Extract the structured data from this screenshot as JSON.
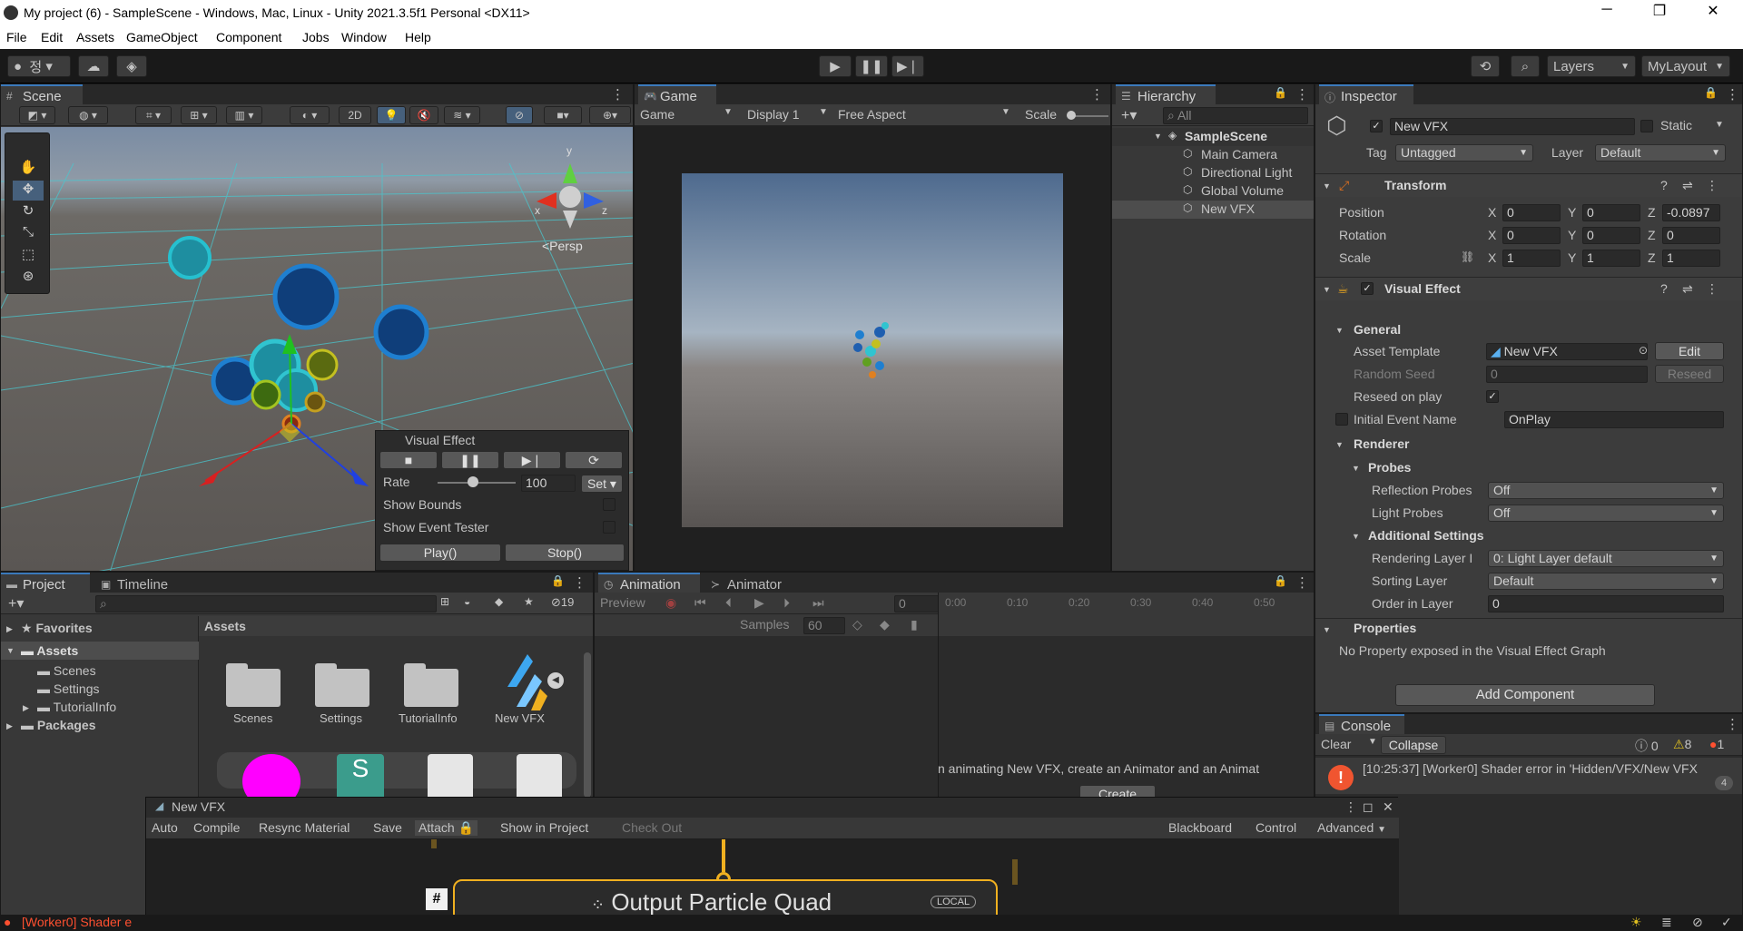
{
  "window": {
    "title": "My project (6) - SampleScene - Windows, Mac, Linux - Unity 2021.3.5f1 Personal <DX11>",
    "minimize": "─",
    "restore": "❐",
    "close": "✕"
  },
  "menu": [
    "File",
    "Edit",
    "Assets",
    "GameObject",
    "Component",
    "Jobs",
    "Window",
    "Help"
  ],
  "toolbar": {
    "account_label": "정",
    "layers_label": "Layers",
    "layout_label": "MyLayout"
  },
  "scene": {
    "tab": "Scene",
    "mode_2d": "2D",
    "persp_label": "<Persp",
    "gizmo_x": "x",
    "gizmo_y": "y",
    "gizmo_z": "z",
    "vfx_overlay": {
      "title": "Visual Effect",
      "rate_label": "Rate",
      "rate_value": "100",
      "set_label": "Set",
      "show_bounds": "Show Bounds",
      "show_event_tester": "Show Event Tester",
      "play": "Play()",
      "stop": "Stop()",
      "rate_fraction": 0.45
    }
  },
  "game": {
    "tab": "Game",
    "mode": "Game",
    "display": "Display 1",
    "aspect": "Free Aspect",
    "scale_label": "Scale"
  },
  "hierarchy": {
    "tab": "Hierarchy",
    "search_placeholder": "All",
    "scene_name": "SampleScene",
    "items": [
      "Main Camera",
      "Directional Light",
      "Global Volume",
      "New VFX"
    ],
    "selected": "New VFX"
  },
  "inspector": {
    "tab": "Inspector",
    "object_name": "New VFX",
    "static_label": "Static",
    "tag_label": "Tag",
    "tag_value": "Untagged",
    "layer_label": "Layer",
    "layer_value": "Default",
    "transform": {
      "title": "Transform",
      "position_label": "Position",
      "rotation_label": "Rotation",
      "scale_label": "Scale",
      "position": {
        "x": "0",
        "y": "0",
        "z": "-0.0897"
      },
      "rotation": {
        "x": "0",
        "y": "0",
        "z": "0"
      },
      "scale": {
        "x": "1",
        "y": "1",
        "z": "1"
      },
      "axis_x": "X",
      "axis_y": "Y",
      "axis_z": "Z"
    },
    "visual_effect": {
      "title": "Visual Effect",
      "general": "General",
      "asset_template_label": "Asset Template",
      "asset_template_value": "New VFX",
      "edit": "Edit",
      "random_seed_label": "Random Seed",
      "random_seed_value": "0",
      "reseed": "Reseed",
      "reseed_on_play_label": "Reseed on play",
      "initial_event_label": "Initial Event Name",
      "initial_event_value": "OnPlay",
      "renderer": "Renderer",
      "probes": "Probes",
      "reflection_probes_label": "Reflection Probes",
      "reflection_probes_value": "Off",
      "light_probes_label": "Light Probes",
      "light_probes_value": "Off",
      "additional_settings": "Additional Settings",
      "rendering_layer_label": "Rendering Layer I",
      "rendering_layer_value": "0: Light Layer default",
      "sorting_layer_label": "Sorting Layer",
      "sorting_layer_value": "Default",
      "order_label": "Order in Layer",
      "order_value": "0",
      "properties": "Properties",
      "no_property": "No Property exposed in the Visual Effect Graph"
    },
    "add_component": "Add Component"
  },
  "project": {
    "tab": "Project",
    "timeline_tab": "Timeline",
    "hidden_count": "19",
    "favorites": "Favorites",
    "assets": "Assets",
    "folders": [
      "Scenes",
      "Settings",
      "TutorialInfo"
    ],
    "packages": "Packages",
    "breadcrumb": "Assets",
    "grid_items": [
      "Scenes",
      "Settings",
      "TutorialInfo",
      "New VFX"
    ]
  },
  "animation": {
    "tab": "Animation",
    "animator_tab": "Animator",
    "preview": "Preview",
    "frame": "0",
    "samples_label": "Samples",
    "samples_value": "60",
    "ticks": [
      "0:00",
      "0:10",
      "0:20",
      "0:30",
      "0:40",
      "0:50"
    ],
    "message": "n animating New VFX, create an Animator and an Animat",
    "create": "Create"
  },
  "console": {
    "tab": "Console",
    "clear": "Clear",
    "collapse": "Collapse",
    "info_count": "0",
    "warn_count": "8",
    "error_count": "1",
    "entry": "[10:25:37] [Worker0] Shader error in 'Hidden/VFX/New VFX",
    "entry_count": "4"
  },
  "vfx_graph": {
    "title": "New VFX",
    "buttons": [
      "Auto",
      "Compile",
      "Resync Material",
      "Save",
      "Attach",
      "Show in Project",
      "Check Out"
    ],
    "right_buttons": [
      "Blackboard",
      "Control",
      "Advanced"
    ],
    "node_title": "Output Particle Quad",
    "node_badge": "LOCAL"
  },
  "status_bar": {
    "message": "[Worker0] Shader e"
  }
}
